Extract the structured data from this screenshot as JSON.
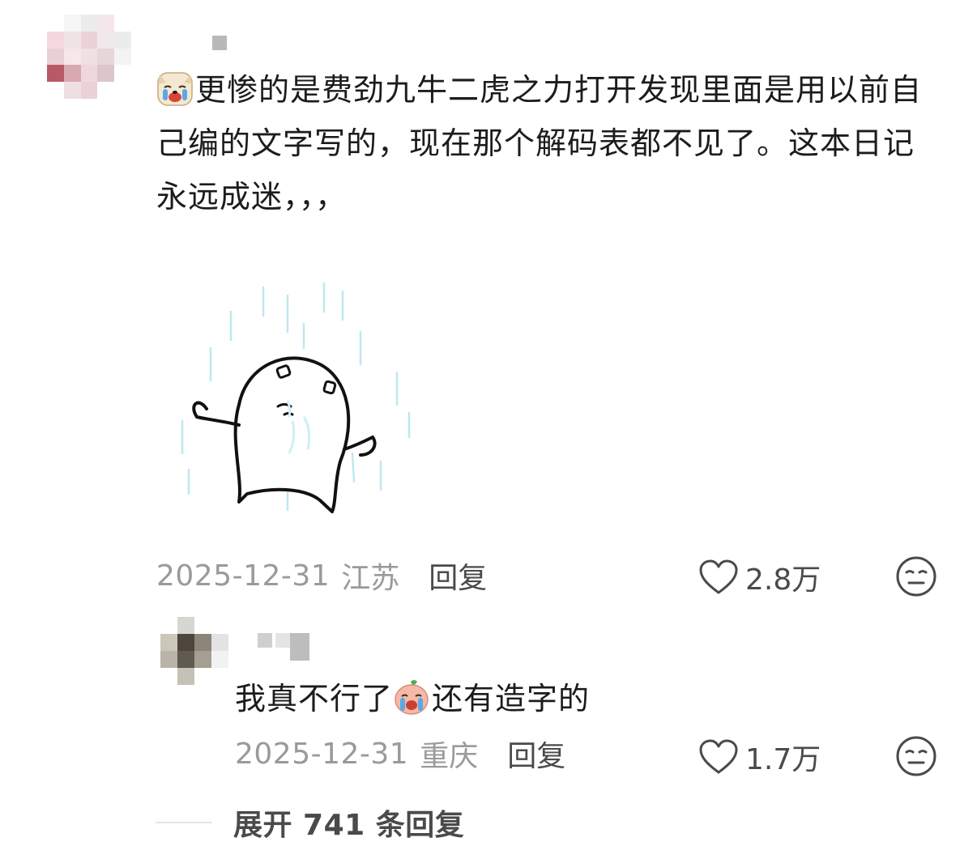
{
  "comment": {
    "text": "更惨的是费劲九牛二虎之力打开发现里面是用以前自己编的文字写的，现在那个解码表都不见了。这本日记永远成迷，，，",
    "date": "2025-12-31",
    "location": "江苏",
    "reply_label": "回复",
    "likes": "2.8万",
    "emoji_icon": "crying-dog-emoji-icon",
    "sticker_icon": "crying-blob-in-rain-sticker"
  },
  "reply": {
    "text_before": "我真不行了",
    "text_after": "还有造字的",
    "emoji_icon": "crying-peach-emoji-icon",
    "date": "2025-12-31",
    "location": "重庆",
    "reply_label": "回复",
    "likes": "1.7万"
  },
  "expand_replies": {
    "label": "展开 741 条回复"
  },
  "colors": {
    "meta_gray": "#9a9a9a",
    "text_dark": "#1c1c1c",
    "action_gray": "#4a4a4a"
  }
}
